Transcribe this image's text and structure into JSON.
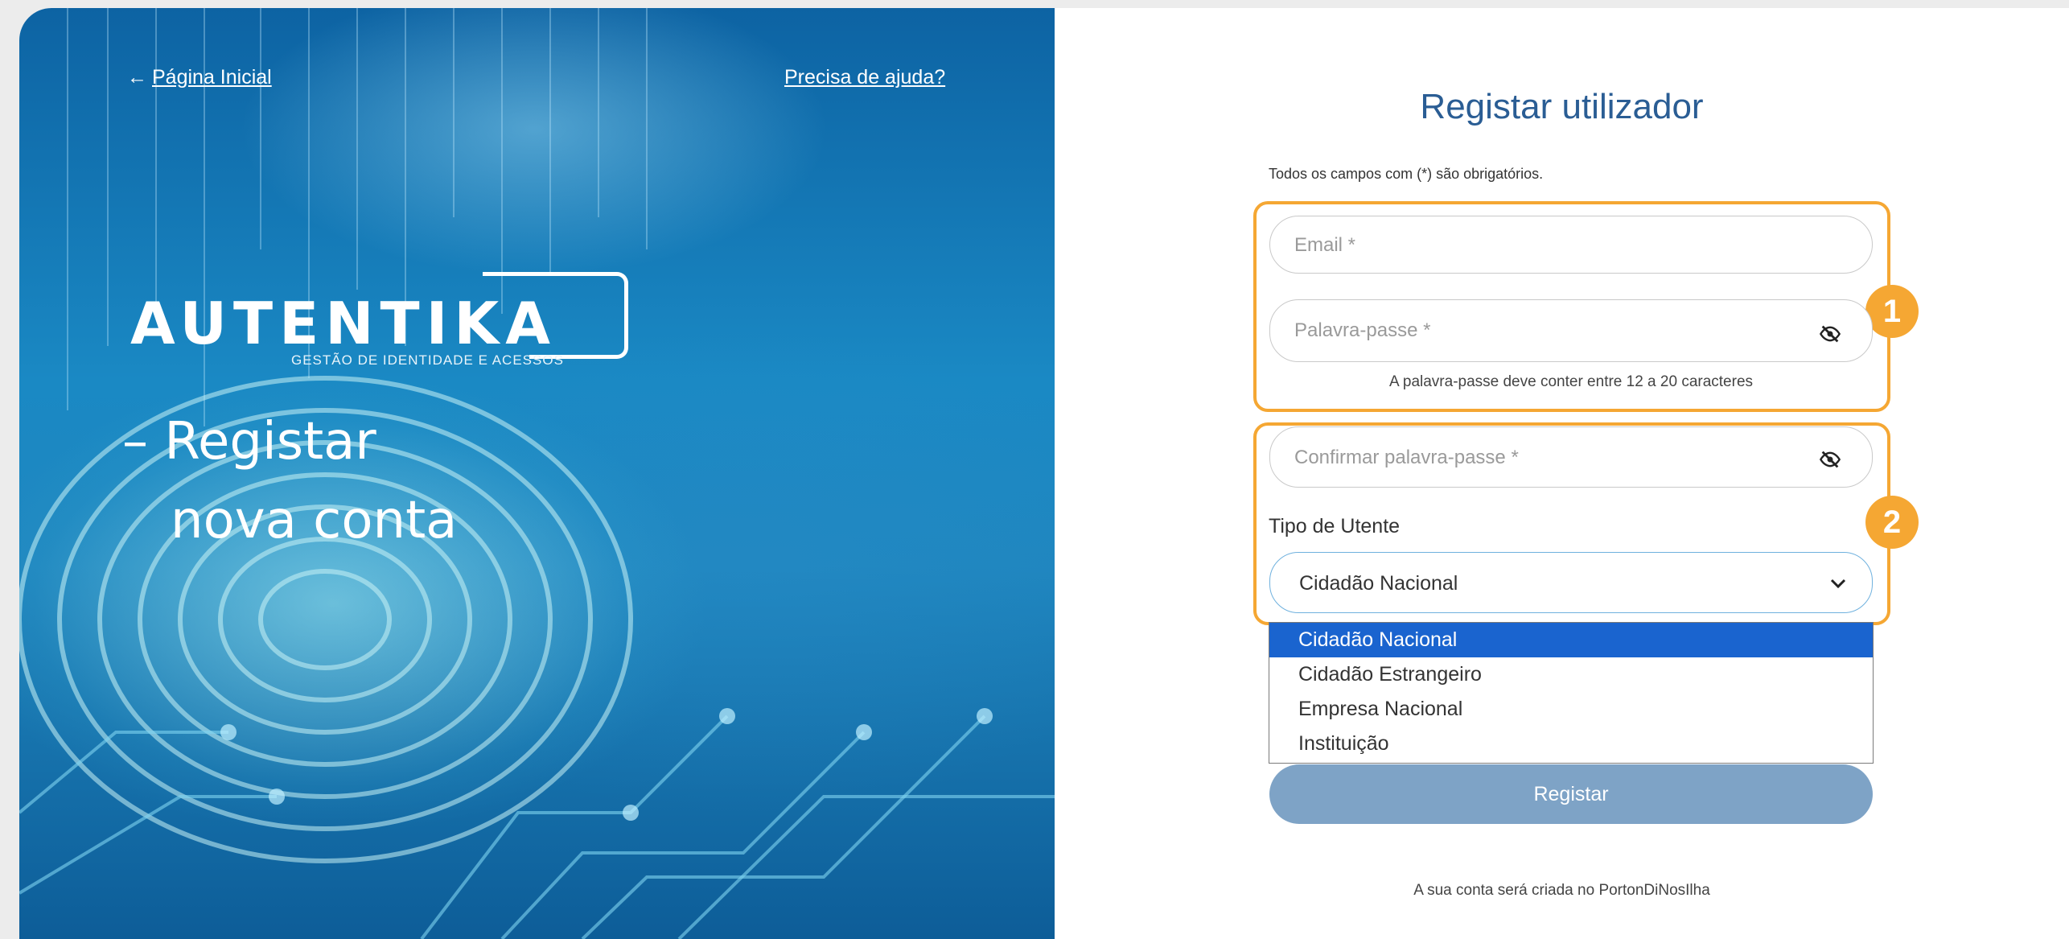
{
  "hero": {
    "back_arrow": "←",
    "back_label": "Página Inicial",
    "help_label": "Precisa de ajuda?",
    "logo_word": "AUTENTIKA",
    "logo_tagline": "GESTÃO DE IDENTIDADE E ACESSOS",
    "slogan_line1": "– Registar",
    "slogan_line2": "nova conta"
  },
  "form": {
    "title": "Registar utilizador",
    "required_note": "Todos os campos com (*) são obrigatórios.",
    "email_placeholder": "Email *",
    "password_placeholder": "Palavra-passe *",
    "password_hint": "A palavra-passe deve conter entre 12 a 20 caracteres",
    "confirm_placeholder": "Confirmar palavra-passe *",
    "user_type_label": "Tipo de Utente",
    "user_type_selected": "Cidadão Nacional",
    "user_type_options": [
      "Cidadão Nacional",
      "Cidadão Estrangeiro",
      "Empresa Nacional",
      "Instituição"
    ],
    "submit_label": "Registar",
    "footer_note": "A sua conta será criada no PortonDiNosIlha"
  },
  "annotations": {
    "badge_1": "1",
    "badge_2": "2",
    "highlight_color": "#f5a733"
  },
  "colors": {
    "title": "#2a5d94",
    "button": "#7ea3c6",
    "option_selected": "#1a64cf"
  }
}
